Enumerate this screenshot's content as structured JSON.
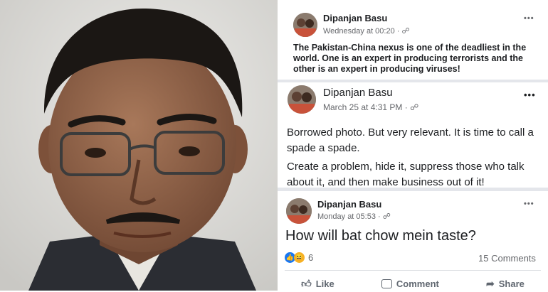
{
  "posts": [
    {
      "author": "Dipanjan Basu",
      "time": "Wednesday at 00:20 · ",
      "menu": "•••",
      "body": "The Pakistan-China nexus is one of the deadliest in the world. One is an expert in producing terrorists and the other is an expert in producing viruses!"
    },
    {
      "author": "Dipanjan Basu",
      "time": "March 25 at 4:31 PM · ",
      "menu": "•••",
      "body1": "Borrowed photo. But very relevant. It is time to call a spade a spade.",
      "body2": "Create a problem, hide it, suppress those who talk about it, and then make business out of it!"
    },
    {
      "author": "Dipanjan Basu",
      "time": "Monday at 05:53 · ",
      "menu": "•••",
      "body": "How will bat chow mein taste?",
      "reactions_count": "6",
      "comments": "15 Comments",
      "actions": {
        "like": "Like",
        "comment": "Comment",
        "share": "Share"
      }
    }
  ],
  "icons": [
    "globe-icon",
    "like-reaction-icon",
    "haha-reaction-icon",
    "thumbs-up-icon",
    "comment-icon",
    "share-icon",
    "more-options-icon"
  ],
  "colors": {
    "like_blue": "#1877f2",
    "haha_yellow": "#f7b125",
    "meta_gray": "#65676b"
  }
}
